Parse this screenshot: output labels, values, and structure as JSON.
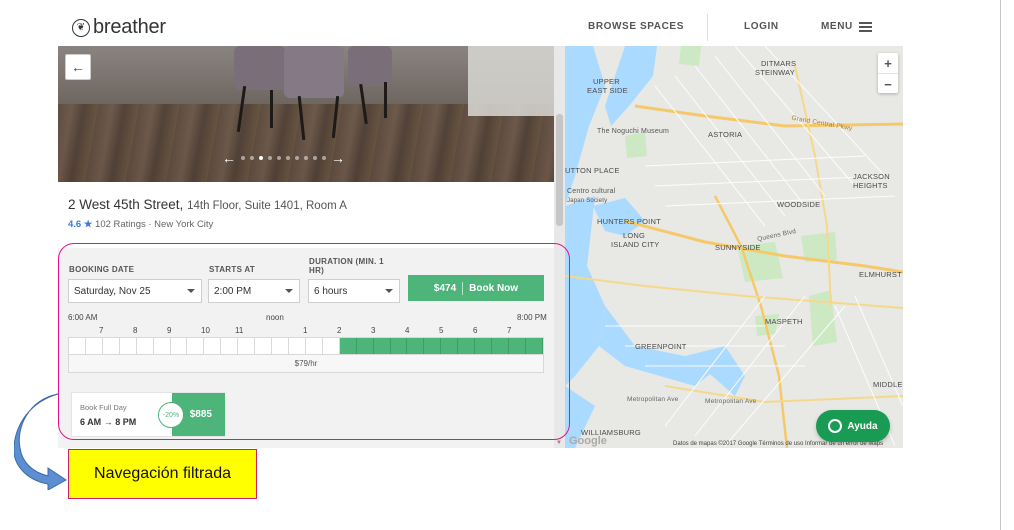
{
  "header": {
    "logo_text": "breather",
    "nav": {
      "browse": "BROWSE SPACES",
      "login": "LOGIN",
      "menu": "MENU"
    }
  },
  "listing": {
    "back_icon": "arrow-left-icon",
    "carousel": {
      "total_slides": 10,
      "active_index": 3
    },
    "address": "2 West 45th Street,",
    "address_detail": "14th Floor, Suite 1401, Room A",
    "rating": "4.6",
    "rating_star": "★",
    "ratings_meta": "102 Ratings · New York City"
  },
  "booking": {
    "date_label": "BOOKING DATE",
    "date_value": "Saturday, Nov 25",
    "starts_label": "STARTS AT",
    "starts_value": "2:00 PM",
    "duration_label_1": "DURATION (MIN. 1",
    "duration_label_2": "HR)",
    "duration_value": "6 hours",
    "book_price": "$474",
    "book_label": "Book Now",
    "timeline": {
      "start_label": "6:00 AM",
      "noon_label": "noon",
      "end_label": "8:00 PM",
      "hours": [
        "7",
        "8",
        "9",
        "10",
        "11",
        "1",
        "2",
        "3",
        "4",
        "5",
        "6",
        "7"
      ],
      "slots_total": 28,
      "selected_from_slot": 16,
      "rate": "$79/hr"
    },
    "full_day": {
      "title": "Book Full Day",
      "from": "6 AM",
      "arrow": "→",
      "to": "8 PM",
      "discount": "-20%",
      "price": "$885"
    }
  },
  "map": {
    "zoom_in": "+",
    "zoom_out": "−",
    "labels": {
      "ditmars": "DITMARS",
      "steinway": "STEINWAY",
      "upper_east": "UPPER",
      "east_side": "EAST SIDE",
      "astoria": "ASTORIA",
      "noguchi": "The Noguchi Museum",
      "grand_central": "Grand Central Pkwy",
      "sutton": "UTTON PLACE",
      "centro": "Centro cultural",
      "japan": "Japan Society",
      "woodside": "WOODSIDE",
      "jackson1": "JACKSON",
      "jackson2": "HEIGHTS",
      "hunters": "HUNTERS POINT",
      "long1": "LONG",
      "long2": "ISLAND CITY",
      "sunnyside": "SUNNYSIDE",
      "elmhurst": "ELMHURST",
      "maspeth": "MASPETH",
      "greenpoint": "GREENPOINT",
      "middle": "MIDDLE V",
      "williamsburg": "WILLIAMSBURG",
      "metropolitan": "Metropolitan Ave",
      "queens_blvd": "Queens Blvd"
    },
    "footer": "Datos de mapas ©2017 Google    Términos de uso    Informar de un error de Maps",
    "google": "Google"
  },
  "chat": {
    "label": "Ayuda"
  },
  "annotation": {
    "note": "Navegación filtrada"
  },
  "colors": {
    "accent_green": "#4db57a",
    "highlight": "#e0148c",
    "note_bg": "#ffff00",
    "chat_green": "#1a9b54"
  }
}
